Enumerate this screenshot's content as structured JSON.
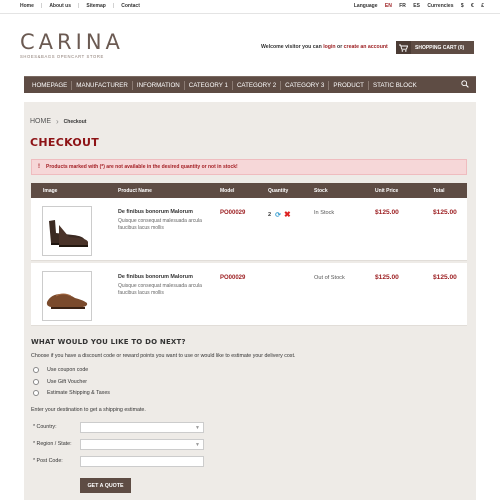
{
  "topbar": {
    "links": [
      "Home",
      "About us",
      "Sitemap",
      "Contact"
    ],
    "language_label": "Language",
    "languages": [
      "EN",
      "FR",
      "ES"
    ],
    "currencies_label": "Currencies",
    "currencies": [
      "$",
      "€",
      "£"
    ]
  },
  "logo": {
    "name": "CARINA",
    "tagline": "SHOES&BAGS OPENCART STORE"
  },
  "header": {
    "welcome_prefix": "Welcome visitor you can",
    "login_link": "login",
    "or_text": "or",
    "register_link": "create an account",
    "cart_label": "SHOPPING CART (0)"
  },
  "nav": {
    "items": [
      "HOMEPAGE",
      "MANUFACTURER",
      "INFORMATION",
      "CATEGORY 1",
      "CATEGORY 2",
      "CATEGORY 3",
      "PRODUCT",
      "STATIC BLOCK"
    ]
  },
  "breadcrumb": {
    "home": "HOME",
    "current": "Checkout"
  },
  "page_title": "CHECKOUT",
  "warning": "Products marked with (*) are not available in the desired quantity or not in stock!",
  "table": {
    "columns": [
      "Image",
      "Product Name",
      "Model",
      "Quantity",
      "Stock",
      "Unit Price",
      "Total"
    ],
    "rows": [
      {
        "name": "De finibus bonorum Malorum",
        "desc": "Quisque consequat malesuada arcula faucibus lacus mollis",
        "model": "PO00029",
        "quantity": "2",
        "stock": "In Stock",
        "unit_price": "$125.00",
        "total": "$125.00"
      },
      {
        "name": "De finibus bonorum Malorum",
        "desc": "Quisque consequat malesuada arcula faucibus lacus mollis",
        "model": "PO00029",
        "stock": "Out of Stock",
        "unit_price": "$125.00",
        "total": "$125.00"
      }
    ]
  },
  "next": {
    "heading": "WHAT WOULD YOU LIKE TO DO NEXT?",
    "description": "Choose if you have a discount code or reward points you want to use or would like to estimate your delivery cost.",
    "options": [
      "Use coupon code",
      "Use Gift Voucher",
      "Estimate Shipping & Taxes"
    ]
  },
  "shipping": {
    "description": "Enter your destination to get a shipping estimate.",
    "country_label": "* Country:",
    "region_label": "* Region / State:",
    "postcode_label": "* Post Code:",
    "quote_button": "GET A QUOTE"
  },
  "colors": {
    "brand": "#5e4c44",
    "accent": "#9b1c1f",
    "background": "#eeebe7"
  }
}
